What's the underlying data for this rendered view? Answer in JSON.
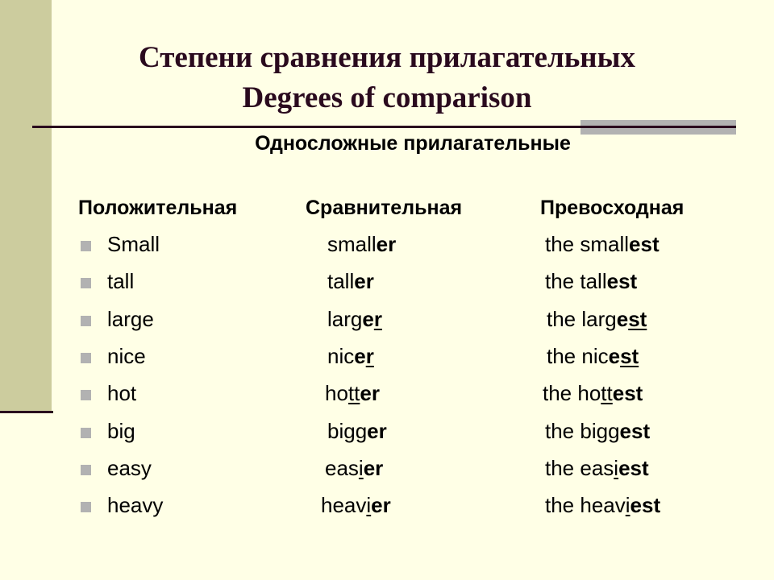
{
  "title": {
    "line1": "Степени сравнения прилагательных",
    "line2": "Degrees of comparison"
  },
  "subtitle": "Односложные прилагательные",
  "headers": {
    "positive": "Положительная",
    "comparative": "Сравнительная",
    "superlative": "Превосходная"
  },
  "colors": {
    "background": "#ffffe6",
    "sidebar": "#cccc9e",
    "title": "#2a0a1e",
    "bullet": "#b2b2b2"
  },
  "rows": [
    {
      "positive": "Small",
      "comparative": [
        {
          "t": "small",
          "s": ""
        },
        {
          "t": "er",
          "s": "b"
        }
      ],
      "superlative": [
        {
          "t": "the small",
          "s": ""
        },
        {
          "t": "est",
          "s": "b"
        }
      ]
    },
    {
      "positive": "tall",
      "comparative": [
        {
          "t": "tall",
          "s": ""
        },
        {
          "t": "er",
          "s": "b"
        }
      ],
      "superlative": [
        {
          "t": "the tall",
          "s": ""
        },
        {
          "t": "est",
          "s": "b"
        }
      ]
    },
    {
      "positive": "large",
      "comparative": [
        {
          "t": "larg",
          "s": ""
        },
        {
          "t": "e",
          "s": "b"
        },
        {
          "t": "r",
          "s": "bu"
        }
      ],
      "superlative": [
        {
          "t": "the larg",
          "s": ""
        },
        {
          "t": "e",
          "s": "b"
        },
        {
          "t": "st",
          "s": "bu"
        }
      ]
    },
    {
      "positive": "nice",
      "comparative": [
        {
          "t": "nic",
          "s": ""
        },
        {
          "t": "e",
          "s": "b"
        },
        {
          "t": "r",
          "s": "bu"
        }
      ],
      "superlative": [
        {
          "t": "the nic",
          "s": ""
        },
        {
          "t": "e",
          "s": "b"
        },
        {
          "t": "st",
          "s": "bu"
        }
      ]
    },
    {
      "positive": "hot",
      "comparative": [
        {
          "t": "ho",
          "s": ""
        },
        {
          "t": "tt",
          "s": "u"
        },
        {
          "t": "er",
          "s": "b"
        }
      ],
      "superlative": [
        {
          "t": "the ho",
          "s": ""
        },
        {
          "t": "tt",
          "s": "u"
        },
        {
          "t": "est",
          "s": "b"
        }
      ]
    },
    {
      "positive": "big",
      "comparative": [
        {
          "t": "bi",
          "s": ""
        },
        {
          "t": "gg",
          "s": "u"
        },
        {
          "t": "er",
          "s": "b"
        }
      ],
      "superlative": [
        {
          "t": "the bi",
          "s": ""
        },
        {
          "t": "gg",
          "s": "u"
        },
        {
          "t": "est",
          "s": "b"
        }
      ]
    },
    {
      "positive": "easy",
      "comparative": [
        {
          "t": "eas",
          "s": ""
        },
        {
          "t": "i",
          "s": "u"
        },
        {
          "t": "er",
          "s": "b"
        }
      ],
      "superlative": [
        {
          "t": "the eas",
          "s": ""
        },
        {
          "t": "i",
          "s": "u"
        },
        {
          "t": "est",
          "s": "b"
        }
      ]
    },
    {
      "positive": "heavy",
      "comparative": [
        {
          "t": "heav",
          "s": ""
        },
        {
          "t": "i",
          "s": "u"
        },
        {
          "t": "er",
          "s": "b"
        }
      ],
      "superlative": [
        {
          "t": "the heav",
          "s": ""
        },
        {
          "t": "i",
          "s": "u"
        },
        {
          "t": "est",
          "s": "b"
        }
      ]
    }
  ]
}
